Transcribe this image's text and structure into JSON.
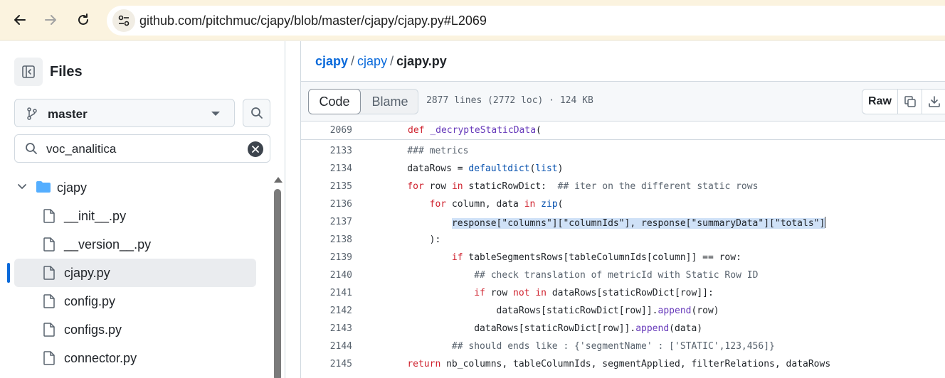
{
  "browser": {
    "url": "github.com/pitchmuc/cjapy/blob/master/cjapy/cjapy.py#L2069"
  },
  "sidebar": {
    "title": "Files",
    "branch": "master",
    "filter_value": "voc_analitica",
    "tree": {
      "folder": "cjapy",
      "files": [
        "__init__.py",
        "__version__.py",
        "cjapy.py",
        "config.py",
        "configs.py",
        "connector.py"
      ],
      "selected": "cjapy.py"
    }
  },
  "breadcrumb": {
    "repo": "cjapy",
    "folder": "cjapy",
    "file": "cjapy.py",
    "separator": "/"
  },
  "file_header": {
    "tab_code": "Code",
    "tab_blame": "Blame",
    "meta": "2877 lines (2772 loc) · 124 KB",
    "raw_label": "Raw"
  },
  "sticky": {
    "number": "2069",
    "text": "def _decrypteStaticData("
  },
  "code": [
    {
      "n": "2133",
      "t": "    ### metrics"
    },
    {
      "n": "2134",
      "t": "    dataRows = defaultdict(list)"
    },
    {
      "n": "2135",
      "t": "    for row in staticRowDict:  ## iter on the different static rows"
    },
    {
      "n": "2136",
      "t": "        for column, data in zip("
    },
    {
      "n": "2137",
      "t": "            response[\"columns\"][\"columnIds\"], response[\"summaryData\"][\"totals\"]"
    },
    {
      "n": "2138",
      "t": "        ):"
    },
    {
      "n": "2139",
      "t": "            if tableSegmentsRows[tableColumnIds[column]] == row:"
    },
    {
      "n": "2140",
      "t": "                ## check translation of metricId with Static Row ID"
    },
    {
      "n": "2141",
      "t": "                if row not in dataRows[staticRowDict[row]]:"
    },
    {
      "n": "2142",
      "t": "                    dataRows[staticRowDict[row]].append(row)"
    },
    {
      "n": "2143",
      "t": "                dataRows[staticRowDict[row]].append(data)"
    },
    {
      "n": "2144",
      "t": "            ## should ends like : {'segmentName' : ['STATIC',123,456]}"
    },
    {
      "n": "2145",
      "t": "    return nb_columns, tableColumnIds, segmentApplied, filterRelations, dataRows"
    }
  ],
  "colors": {
    "keyword": "#cf222e",
    "function": "#6639ba",
    "builtin": "#0550ae",
    "string": "#0a3069",
    "comment": "#59636e",
    "link": "#0969da",
    "selection": "#cfe1f7"
  }
}
